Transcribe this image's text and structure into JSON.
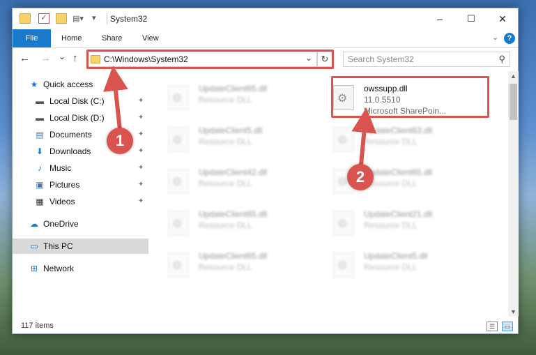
{
  "window": {
    "title": "System32",
    "controls": {
      "minimize": "–",
      "maximize": "☐",
      "close": "✕"
    }
  },
  "ribbon": {
    "tabs": [
      "File",
      "Home",
      "Share",
      "View"
    ],
    "expand_icon": "chevron-down-icon",
    "help_label": "?"
  },
  "nav": {
    "back": "←",
    "forward": "→",
    "recent": "⌄",
    "up": "↑",
    "address": "C:\\Windows\\System32",
    "refresh": "↻",
    "search_placeholder": "Search System32"
  },
  "sidebar": {
    "items": [
      {
        "label": "Quick access",
        "icon": "star-icon",
        "glyph": "★",
        "pinned": false
      },
      {
        "label": "Local Disk (C:)",
        "icon": "drive-icon",
        "glyph": "▬",
        "pinned": true
      },
      {
        "label": "Local Disk (D:)",
        "icon": "drive-icon",
        "glyph": "▬",
        "pinned": true
      },
      {
        "label": "Documents",
        "icon": "documents-icon",
        "glyph": "▤",
        "pinned": true
      },
      {
        "label": "Downloads",
        "icon": "downloads-icon",
        "glyph": "⬇",
        "pinned": true
      },
      {
        "label": "Music",
        "icon": "music-icon",
        "glyph": "♪",
        "pinned": true
      },
      {
        "label": "Pictures",
        "icon": "pictures-icon",
        "glyph": "▣",
        "pinned": true
      },
      {
        "label": "Videos",
        "icon": "videos-icon",
        "glyph": "▦",
        "pinned": true
      },
      {
        "label": "OneDrive",
        "icon": "cloud-icon",
        "glyph": "☁",
        "pinned": false
      },
      {
        "label": "This PC",
        "icon": "computer-icon",
        "glyph": "▭",
        "pinned": false,
        "selected": true
      },
      {
        "label": "Network",
        "icon": "network-icon",
        "glyph": "⊞",
        "pinned": false
      }
    ],
    "pin_glyph": "📌"
  },
  "files": [
    {
      "name": "UpdateClient65.dll",
      "type": "Resource DLL",
      "blurred": true
    },
    {
      "name": "owssupp.dll",
      "version": "11.0.5510",
      "company": "Microsoft SharePoin...",
      "blurred": false
    },
    {
      "name": "UpdateClient5.dll",
      "type": "Resource DLL",
      "blurred": true
    },
    {
      "name": "UpdateClient63.dll",
      "type": "Resource DLL",
      "blurred": true
    },
    {
      "name": "UpdateClient42.dll",
      "type": "Resource DLL",
      "blurred": true
    },
    {
      "name": "UpdateClient65.dll",
      "type": "Resource DLL",
      "blurred": true
    },
    {
      "name": "UpdateClient65.dll",
      "type": "Resource DLL",
      "blurred": true
    },
    {
      "name": "UpdateClient21.dll",
      "type": "Resource DLL",
      "blurred": true
    },
    {
      "name": "UpdateClient65.dll",
      "type": "Resource DLL",
      "blurred": true
    },
    {
      "name": "UpdateClient5.dll",
      "type": "Resource DLL",
      "blurred": true
    }
  ],
  "status": {
    "count": "117 items"
  },
  "annotations": {
    "step1": "1",
    "step2": "2",
    "color": "#d9534f"
  }
}
